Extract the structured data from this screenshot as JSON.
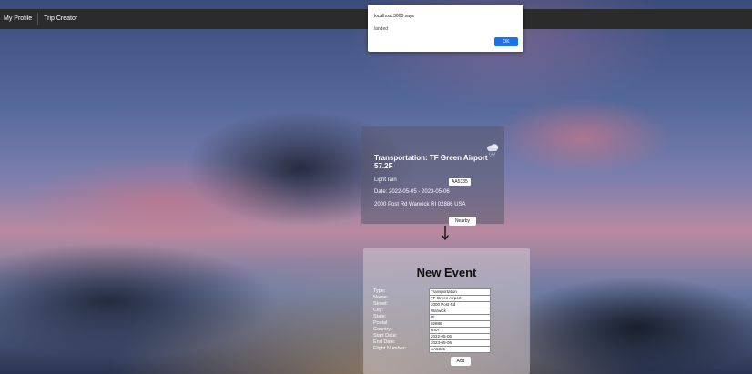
{
  "nav": {
    "items": [
      "My Profile",
      "Trip Creator"
    ]
  },
  "alert": {
    "title": "localhost:3000 says",
    "message": "landed",
    "ok_label": "OK",
    "button_color": "#1a73e8"
  },
  "weather_card": {
    "title": "Transportation: TF Green Airport",
    "temperature": "57.2F",
    "condition": "Light rain",
    "flight_number": "AA5335",
    "dates": "Date: 2022-05-05 - 2023-05-06",
    "address": "2000 Post Rd Warwick RI 02886 USA",
    "icon": "rain-cloud-icon",
    "nearby_label": "Nearby"
  },
  "form": {
    "title": "New Event",
    "fields": [
      {
        "label": "Type:",
        "value": "Transportation"
      },
      {
        "label": "Name:",
        "value": "TF Green Airport"
      },
      {
        "label": "Street:",
        "value": "2000 Post Rd"
      },
      {
        "label": "City:",
        "value": "Warwick"
      },
      {
        "label": "State:",
        "value": "RI"
      },
      {
        "label": "Postal:",
        "value": "02886"
      },
      {
        "label": "Country:",
        "value": "USA"
      },
      {
        "label": "Start Date:",
        "value": "2022-05-05"
      },
      {
        "label": "End Date:",
        "value": "2023-05-06"
      },
      {
        "label": "Flight Number:",
        "value": "AA5335"
      }
    ],
    "add_label": "Add"
  }
}
